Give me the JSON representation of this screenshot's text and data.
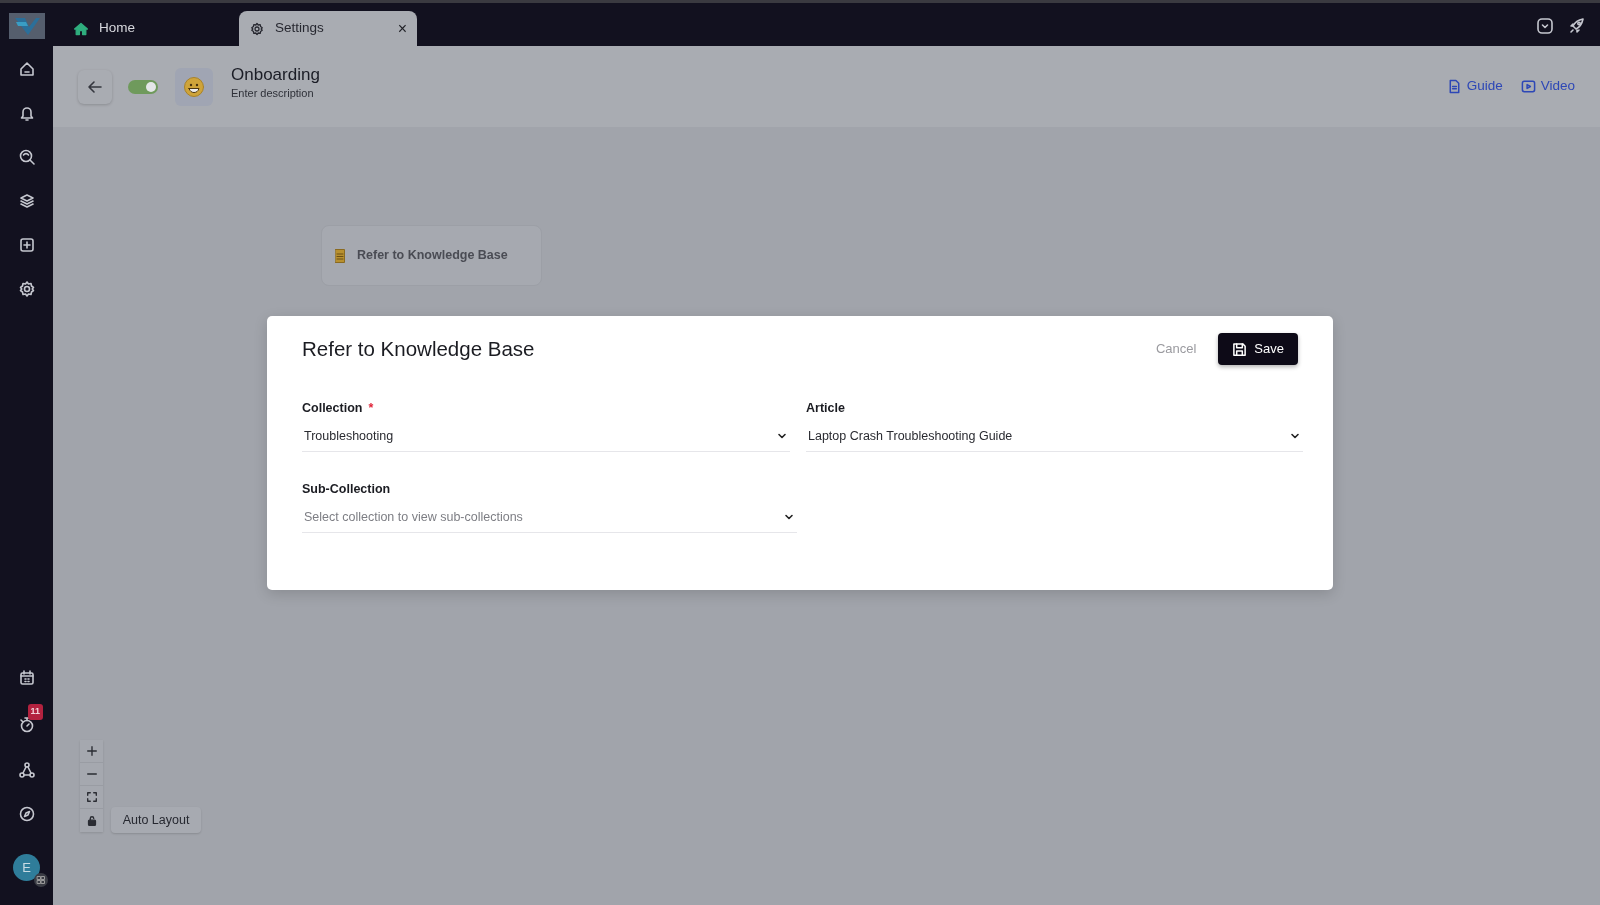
{
  "tabs": [
    {
      "label": "Home",
      "selected": false
    },
    {
      "label": "Settings",
      "selected": true,
      "close": "×"
    }
  ],
  "sidebar": {
    "badge": "11",
    "avatar": "E"
  },
  "header": {
    "enabled": true,
    "title": "Onboarding",
    "description": "Enter description",
    "links": [
      {
        "label": "Guide"
      },
      {
        "label": "Video"
      }
    ]
  },
  "canvas": {
    "node": {
      "label": "Refer to Knowledge Base"
    },
    "auto_layout": "Auto Layout"
  },
  "modal": {
    "title": "Refer to Knowledge Base",
    "cancel": "Cancel",
    "save": "Save",
    "fields": [
      {
        "label": "Collection",
        "required_mark": "*",
        "value": "Troubleshooting"
      },
      {
        "label": "Article",
        "value": "Laptop Crash Troubleshooting Guide"
      },
      {
        "label": "Sub-Collection",
        "placeholder": "Select collection to view sub-collections"
      }
    ]
  }
}
